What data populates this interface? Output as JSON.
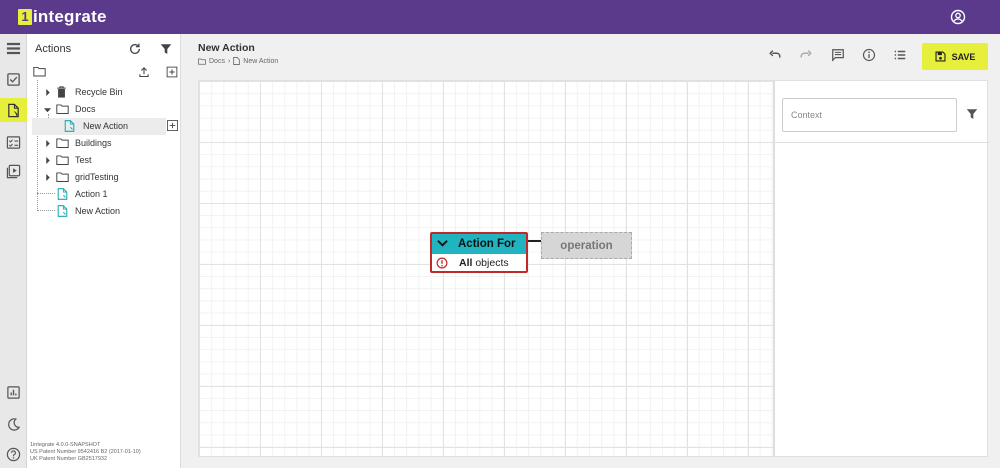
{
  "app": {
    "logo_mark": "1",
    "logo_text": "integrate"
  },
  "topbar": {
    "user_icon": "account-circle-icon"
  },
  "rail": {
    "items": [
      {
        "icon": "list-icon"
      },
      {
        "icon": "checkbox-icon"
      },
      {
        "icon": "action-file-icon",
        "active": true
      },
      {
        "icon": "checklist-icon"
      },
      {
        "icon": "playlist-play-icon"
      }
    ],
    "bottom": [
      {
        "icon": "report-chart-icon"
      },
      {
        "icon": "dark-mode-moon-icon"
      },
      {
        "icon": "help-icon"
      }
    ]
  },
  "actions_panel": {
    "title": "Actions",
    "tree": [
      {
        "label": "Recycle Bin",
        "type": "trash",
        "level": 1,
        "expandable": true
      },
      {
        "label": "Docs",
        "type": "folder",
        "level": 1,
        "expanded": true
      },
      {
        "label": "New Action",
        "type": "action",
        "level": 2,
        "selected": true
      },
      {
        "label": "Buildings",
        "type": "folder",
        "level": 1,
        "expandable": true
      },
      {
        "label": "Test",
        "type": "folder",
        "level": 1,
        "expandable": true
      },
      {
        "label": "gridTesting",
        "type": "folder",
        "level": 1,
        "expandable": true
      },
      {
        "label": "Action 1",
        "type": "action",
        "level": 1
      },
      {
        "label": "New Action",
        "type": "action",
        "level": 1
      }
    ],
    "footer": [
      "1integrate 4.0.0-SNAPSHOT",
      "US Patent Number 9542416 B2 (2017-01-10)",
      "UK Patent Number GB2517932"
    ]
  },
  "header": {
    "title": "New Action",
    "breadcrumb": [
      "Docs",
      "New Action"
    ],
    "save_label": "SAVE"
  },
  "canvas": {
    "node": {
      "title": "Action For",
      "body_bold": "All",
      "body_rest": " objects",
      "status_color": "#c0282a",
      "header_color": "#20b3c0"
    },
    "operation_label": "operation"
  },
  "right_panel": {
    "context_placeholder": "Context",
    "context_value": ""
  },
  "colors": {
    "brand": "#5b3a8c",
    "accent": "#e6ef3c"
  }
}
